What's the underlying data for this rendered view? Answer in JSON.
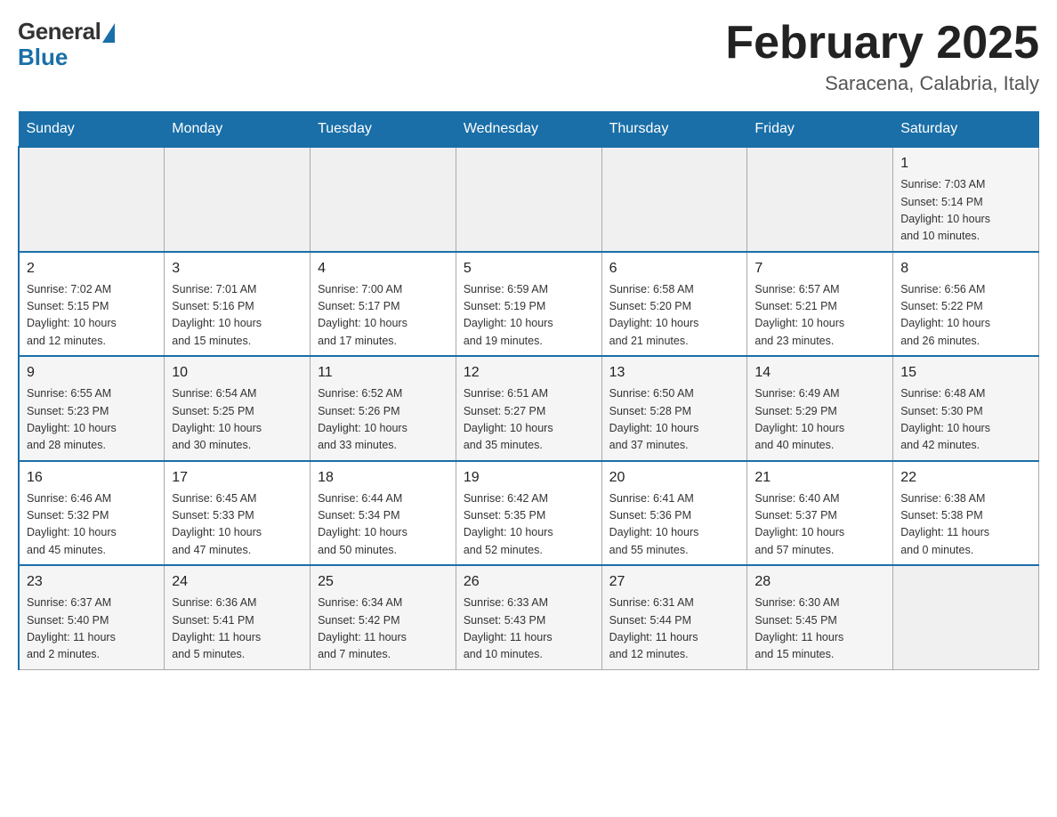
{
  "logo": {
    "general_text": "General",
    "blue_text": "Blue"
  },
  "header": {
    "month_year": "February 2025",
    "location": "Saracena, Calabria, Italy"
  },
  "weekdays": [
    "Sunday",
    "Monday",
    "Tuesday",
    "Wednesday",
    "Thursday",
    "Friday",
    "Saturday"
  ],
  "weeks": [
    [
      {
        "day": "",
        "info": ""
      },
      {
        "day": "",
        "info": ""
      },
      {
        "day": "",
        "info": ""
      },
      {
        "day": "",
        "info": ""
      },
      {
        "day": "",
        "info": ""
      },
      {
        "day": "",
        "info": ""
      },
      {
        "day": "1",
        "info": "Sunrise: 7:03 AM\nSunset: 5:14 PM\nDaylight: 10 hours\nand 10 minutes."
      }
    ],
    [
      {
        "day": "2",
        "info": "Sunrise: 7:02 AM\nSunset: 5:15 PM\nDaylight: 10 hours\nand 12 minutes."
      },
      {
        "day": "3",
        "info": "Sunrise: 7:01 AM\nSunset: 5:16 PM\nDaylight: 10 hours\nand 15 minutes."
      },
      {
        "day": "4",
        "info": "Sunrise: 7:00 AM\nSunset: 5:17 PM\nDaylight: 10 hours\nand 17 minutes."
      },
      {
        "day": "5",
        "info": "Sunrise: 6:59 AM\nSunset: 5:19 PM\nDaylight: 10 hours\nand 19 minutes."
      },
      {
        "day": "6",
        "info": "Sunrise: 6:58 AM\nSunset: 5:20 PM\nDaylight: 10 hours\nand 21 minutes."
      },
      {
        "day": "7",
        "info": "Sunrise: 6:57 AM\nSunset: 5:21 PM\nDaylight: 10 hours\nand 23 minutes."
      },
      {
        "day": "8",
        "info": "Sunrise: 6:56 AM\nSunset: 5:22 PM\nDaylight: 10 hours\nand 26 minutes."
      }
    ],
    [
      {
        "day": "9",
        "info": "Sunrise: 6:55 AM\nSunset: 5:23 PM\nDaylight: 10 hours\nand 28 minutes."
      },
      {
        "day": "10",
        "info": "Sunrise: 6:54 AM\nSunset: 5:25 PM\nDaylight: 10 hours\nand 30 minutes."
      },
      {
        "day": "11",
        "info": "Sunrise: 6:52 AM\nSunset: 5:26 PM\nDaylight: 10 hours\nand 33 minutes."
      },
      {
        "day": "12",
        "info": "Sunrise: 6:51 AM\nSunset: 5:27 PM\nDaylight: 10 hours\nand 35 minutes."
      },
      {
        "day": "13",
        "info": "Sunrise: 6:50 AM\nSunset: 5:28 PM\nDaylight: 10 hours\nand 37 minutes."
      },
      {
        "day": "14",
        "info": "Sunrise: 6:49 AM\nSunset: 5:29 PM\nDaylight: 10 hours\nand 40 minutes."
      },
      {
        "day": "15",
        "info": "Sunrise: 6:48 AM\nSunset: 5:30 PM\nDaylight: 10 hours\nand 42 minutes."
      }
    ],
    [
      {
        "day": "16",
        "info": "Sunrise: 6:46 AM\nSunset: 5:32 PM\nDaylight: 10 hours\nand 45 minutes."
      },
      {
        "day": "17",
        "info": "Sunrise: 6:45 AM\nSunset: 5:33 PM\nDaylight: 10 hours\nand 47 minutes."
      },
      {
        "day": "18",
        "info": "Sunrise: 6:44 AM\nSunset: 5:34 PM\nDaylight: 10 hours\nand 50 minutes."
      },
      {
        "day": "19",
        "info": "Sunrise: 6:42 AM\nSunset: 5:35 PM\nDaylight: 10 hours\nand 52 minutes."
      },
      {
        "day": "20",
        "info": "Sunrise: 6:41 AM\nSunset: 5:36 PM\nDaylight: 10 hours\nand 55 minutes."
      },
      {
        "day": "21",
        "info": "Sunrise: 6:40 AM\nSunset: 5:37 PM\nDaylight: 10 hours\nand 57 minutes."
      },
      {
        "day": "22",
        "info": "Sunrise: 6:38 AM\nSunset: 5:38 PM\nDaylight: 11 hours\nand 0 minutes."
      }
    ],
    [
      {
        "day": "23",
        "info": "Sunrise: 6:37 AM\nSunset: 5:40 PM\nDaylight: 11 hours\nand 2 minutes."
      },
      {
        "day": "24",
        "info": "Sunrise: 6:36 AM\nSunset: 5:41 PM\nDaylight: 11 hours\nand 5 minutes."
      },
      {
        "day": "25",
        "info": "Sunrise: 6:34 AM\nSunset: 5:42 PM\nDaylight: 11 hours\nand 7 minutes."
      },
      {
        "day": "26",
        "info": "Sunrise: 6:33 AM\nSunset: 5:43 PM\nDaylight: 11 hours\nand 10 minutes."
      },
      {
        "day": "27",
        "info": "Sunrise: 6:31 AM\nSunset: 5:44 PM\nDaylight: 11 hours\nand 12 minutes."
      },
      {
        "day": "28",
        "info": "Sunrise: 6:30 AM\nSunset: 5:45 PM\nDaylight: 11 hours\nand 15 minutes."
      },
      {
        "day": "",
        "info": ""
      }
    ]
  ]
}
